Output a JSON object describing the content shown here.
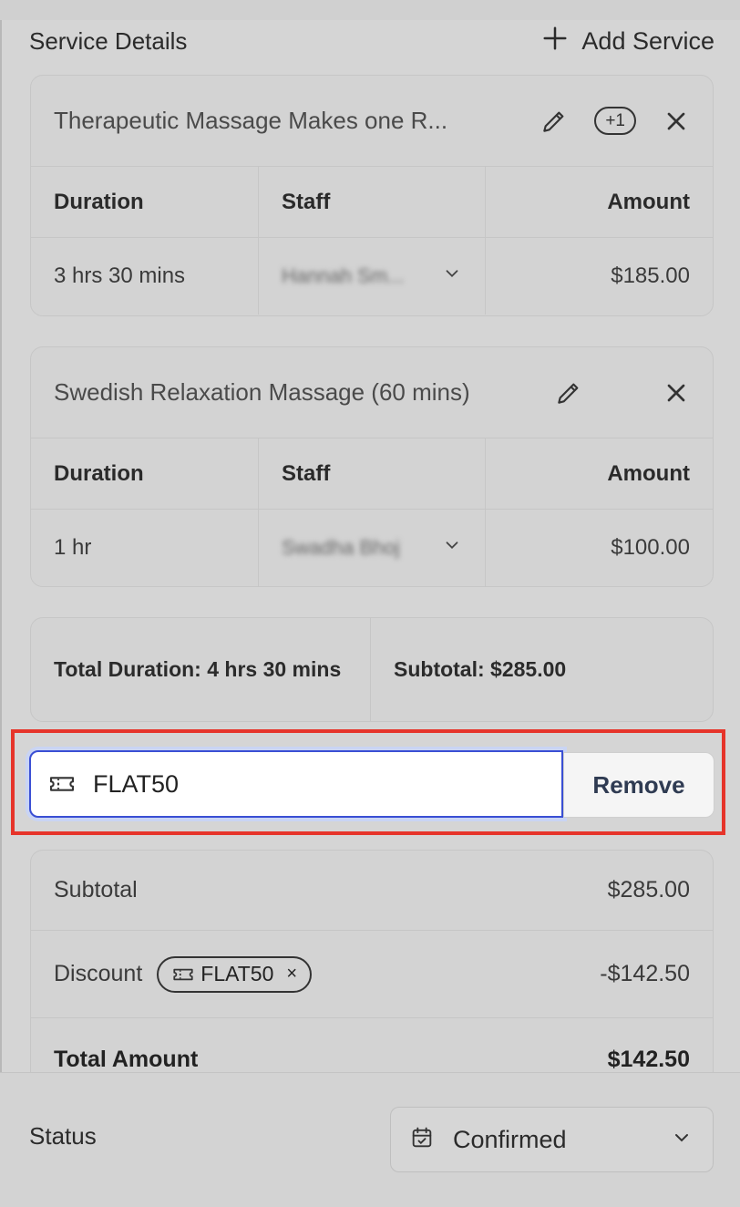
{
  "header": {
    "title": "Service Details",
    "add_service": "Add Service"
  },
  "services": [
    {
      "title": "Therapeutic Massage Makes one R...",
      "extra_count": "+1",
      "columns": [
        "Duration",
        "Staff",
        "Amount"
      ],
      "duration": "3 hrs 30 mins",
      "staff": "Hannah Sm...",
      "amount": "$185.00"
    },
    {
      "title": "Swedish Relaxation Massage (60 mins)",
      "columns": [
        "Duration",
        "Staff",
        "Amount"
      ],
      "duration": "1 hr",
      "staff": "Swadha Bhoj",
      "amount": "$100.00"
    }
  ],
  "totals": {
    "duration_label": "Total Duration: 4 hrs 30 mins",
    "subtotal_label": "Subtotal: $285.00"
  },
  "coupon": {
    "code": "FLAT50",
    "remove_label": "Remove"
  },
  "summary": {
    "subtotal_label": "Subtotal",
    "subtotal_value": "$285.00",
    "discount_label": "Discount",
    "discount_code": "FLAT50",
    "discount_remove": "×",
    "discount_value": "-$142.50",
    "total_label": "Total Amount",
    "total_value": "$142.50"
  },
  "status": {
    "label": "Status",
    "value": "Confirmed"
  },
  "colors": {
    "highlight": "#e6342a",
    "focus": "#3a4fd4",
    "overlay": "#d3d3d3"
  }
}
